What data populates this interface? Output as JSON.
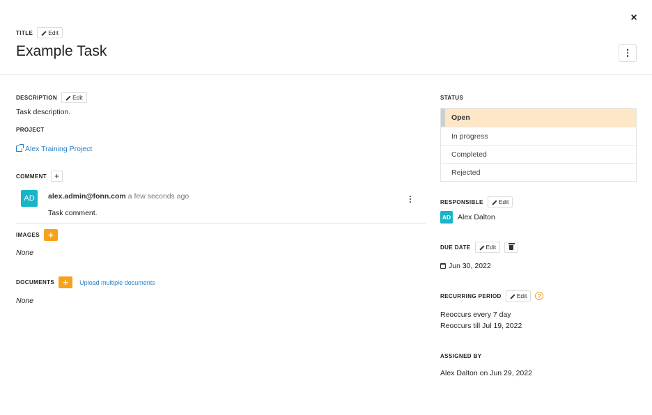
{
  "header": {
    "title_label": "TITLE",
    "edit_label": "Edit",
    "title": "Example Task",
    "close_glyph": "×"
  },
  "description": {
    "label": "DESCRIPTION",
    "edit_label": "Edit",
    "text": "Task description."
  },
  "project": {
    "label": "PROJECT",
    "link_text": "Alex Training Project"
  },
  "comment": {
    "label": "COMMENT",
    "add_glyph": "+",
    "items": [
      {
        "avatar": "AD",
        "author": "alex.admin@fonn.com",
        "time": "a few seconds ago",
        "text": "Task comment."
      }
    ]
  },
  "images": {
    "label": "IMAGES",
    "add_glyph": "+",
    "empty_text": "None"
  },
  "documents": {
    "label": "DOCUMENTS",
    "add_glyph": "+",
    "upload_link": "Upload multiple documents",
    "empty_text": "None"
  },
  "status": {
    "label": "STATUS",
    "options": [
      "Open",
      "In progress",
      "Completed",
      "Rejected"
    ],
    "selected": "Open"
  },
  "responsible": {
    "label": "RESPONSIBLE",
    "edit_label": "Edit",
    "avatar": "AD",
    "name": "Alex Dalton"
  },
  "due_date": {
    "label": "DUE DATE",
    "edit_label": "Edit",
    "value": "Jun 30, 2022"
  },
  "recurring": {
    "label": "RECURRING PERIOD",
    "edit_label": "Edit",
    "help_glyph": "?",
    "line1": "Reoccurs every 7 day",
    "line2": "Reoccurs till Jul 19, 2022"
  },
  "assigned_by": {
    "label": "ASSIGNED BY",
    "text": "Alex Dalton on Jun 29, 2022"
  },
  "colors": {
    "accent_orange": "#f7a21b",
    "link_blue": "#2a7fc3",
    "avatar_teal": "#18b4c8",
    "status_selected_bg": "#fde7c7"
  },
  "icons": {
    "close": "close-icon",
    "more": "more-vertical-icon",
    "edit": "pencil-icon",
    "external_link": "external-link-icon",
    "calendar": "calendar-icon",
    "trash": "trash-icon",
    "help": "question-circle-icon"
  }
}
